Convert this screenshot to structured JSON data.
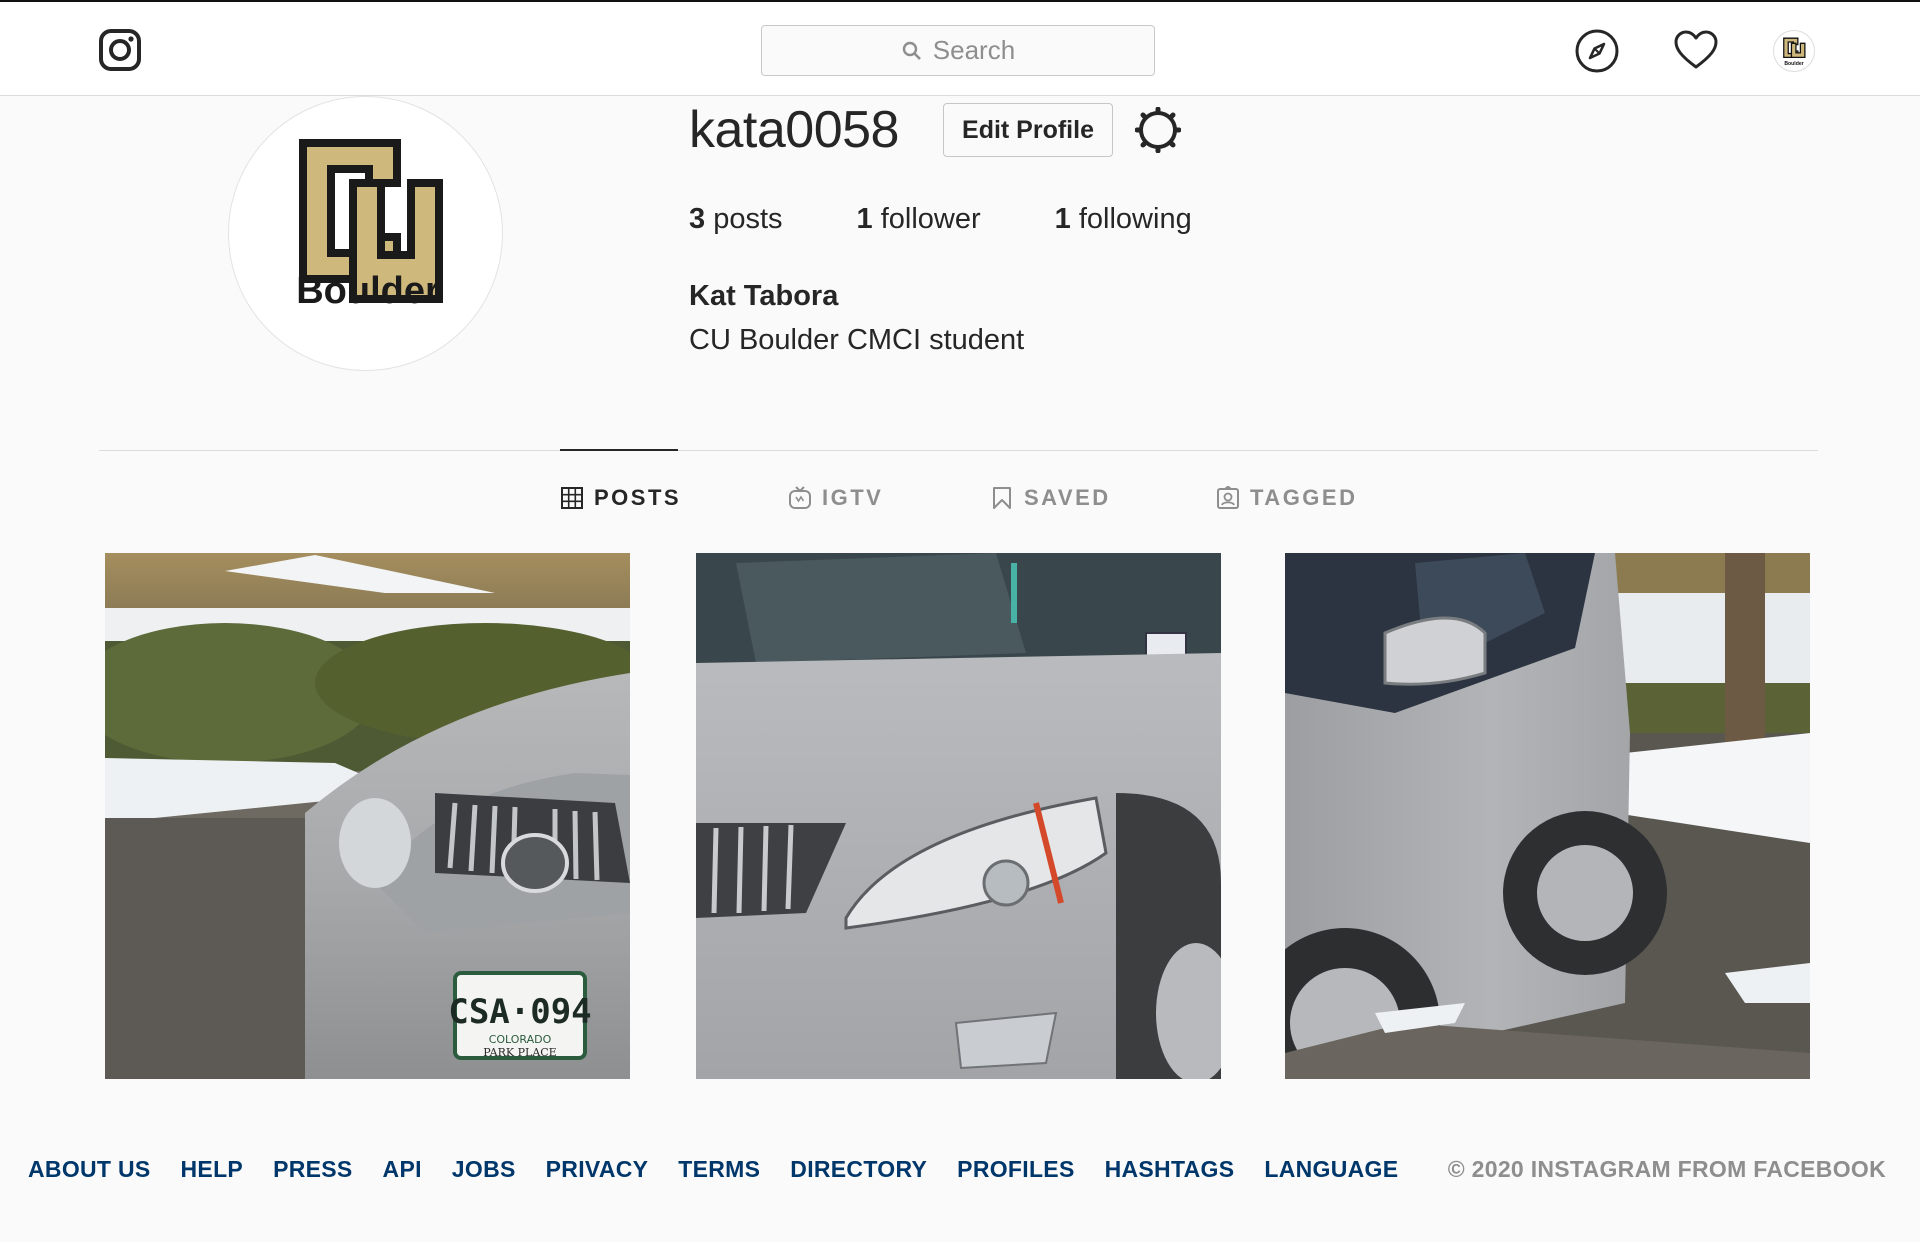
{
  "navbar": {
    "search_placeholder": "Search",
    "icons": [
      "instagram-logo-icon",
      "search-icon",
      "compass-icon",
      "heart-icon",
      "avatar"
    ]
  },
  "profile": {
    "username": "kata0058",
    "edit_button": "Edit Profile",
    "stats": [
      {
        "count": "3",
        "label": " posts"
      },
      {
        "count": "1",
        "label": " follower"
      },
      {
        "count": "1",
        "label": " following"
      }
    ],
    "full_name": "Kat Tabora",
    "bio": "CU Boulder CMCI student",
    "avatar_logo_text": "Boulder"
  },
  "tabs": [
    {
      "label": "POSTS",
      "icon": "grid-icon",
      "active": true
    },
    {
      "label": "IGTV",
      "icon": "igtv-icon",
      "active": false
    },
    {
      "label": "SAVED",
      "icon": "bookmark-icon",
      "active": false
    },
    {
      "label": "TAGGED",
      "icon": "tagged-icon",
      "active": false
    }
  ],
  "posts": [
    {
      "description": "front of silver Lexus SUV",
      "plate": "CSA·094",
      "plate_state": "COLORADO",
      "plate_dealer": "PARK PLACE"
    },
    {
      "description": "silver Lexus hood and headlight"
    },
    {
      "description": "side of silver Lexus SUV"
    }
  ],
  "footer": {
    "links": [
      "ABOUT US",
      "HELP",
      "PRESS",
      "API",
      "JOBS",
      "PRIVACY",
      "TERMS",
      "DIRECTORY",
      "PROFILES",
      "HASHTAGS",
      "LANGUAGE"
    ],
    "copyright": "© 2020 INSTAGRAM FROM FACEBOOK"
  },
  "colors": {
    "link": "#00376b",
    "muted": "#8e8e8e",
    "text": "#262626",
    "cu_gold": "#cfb87c"
  }
}
